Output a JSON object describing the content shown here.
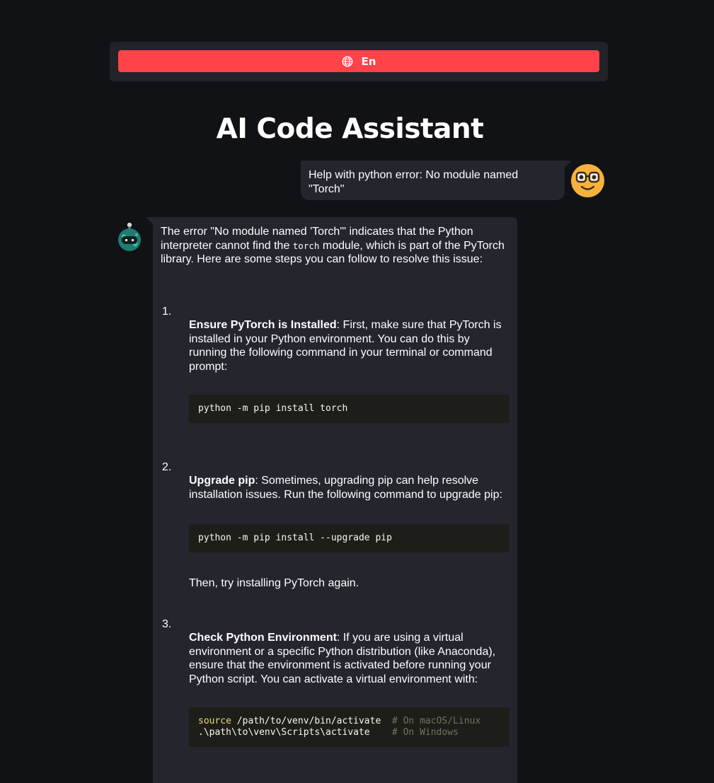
{
  "language": {
    "label": "En",
    "icon": "globe-icon"
  },
  "title": "AI Code Assistant",
  "user_message": {
    "text": "Help with python error: No module named \"Torch\"",
    "avatar": "nerd-face-emoji-avatar"
  },
  "assistant_message": {
    "avatar": "robot-avatar",
    "intro_before": "The error \"No module named 'Torch'\" indicates that the Python interpreter cannot find the ",
    "intro_code": "torch",
    "intro_after": " module, which is part of the PyTorch library. Here are some steps you can follow to resolve this issue:",
    "steps": [
      {
        "number": "1.",
        "heading": "Ensure PyTorch is Installed",
        "text": ": First, make sure that PyTorch is installed in your Python environment. You can do this by running the following command in your terminal or command prompt:",
        "code": "python -m pip install torch"
      },
      {
        "number": "2.",
        "heading": "Upgrade pip",
        "text": ": Sometimes, upgrading pip can help resolve installation issues. Run the following command to upgrade pip:",
        "code": "python -m pip install --upgrade pip",
        "after": "Then, try installing PyTorch again."
      },
      {
        "number": "3.",
        "heading": "Check Python Environment",
        "text": ": If you are using a virtual environment or a specific Python distribution (like Anaconda), ensure that the environment is activated before running your Python script. You can activate a virtual environment with:",
        "code_line1_keyword": "source",
        "code_line1_rest": " /path/to/venv/bin/activate  ",
        "code_line1_comment": "# On macOS/Linux",
        "code_line2_rest": ".\\path\\to\\venv\\Scripts\\activate    ",
        "code_line2_comment": "# On Windows"
      }
    ]
  },
  "colors": {
    "background": "#111216",
    "bubble": "#24252d",
    "accent": "#ff4348",
    "code_bg": "#1d1e19"
  }
}
